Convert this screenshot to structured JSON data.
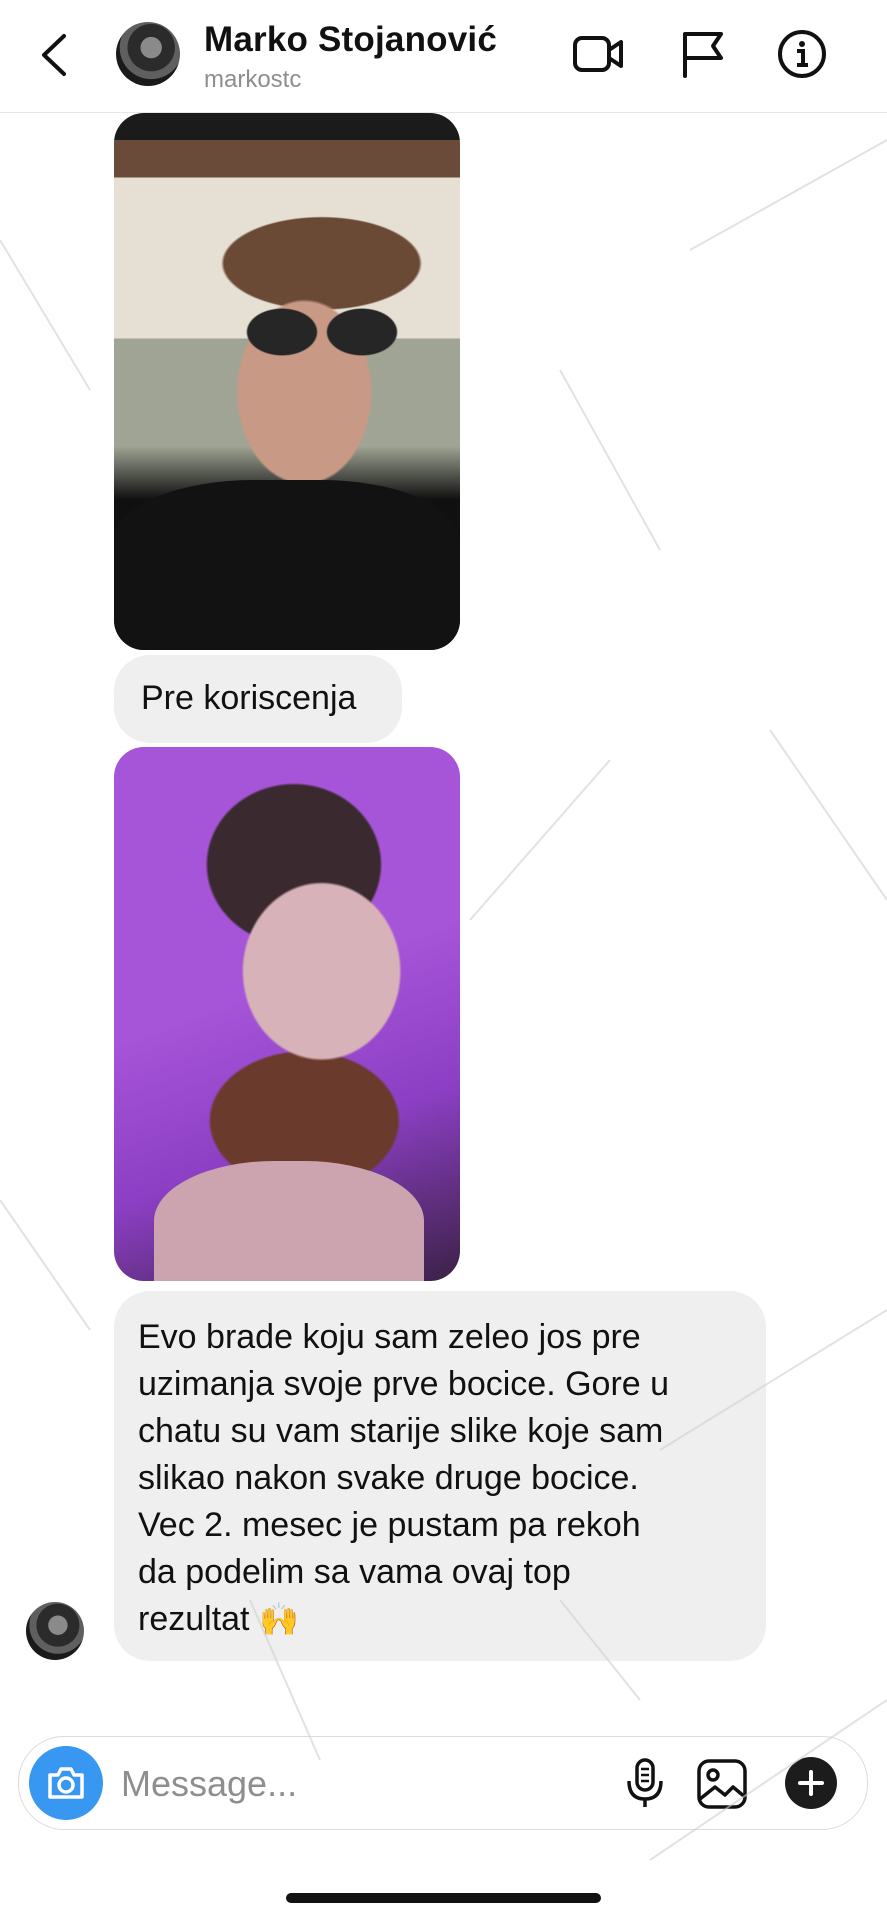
{
  "header": {
    "name": "Marko Stojanović",
    "username": "markostc",
    "icons": [
      "back-chevron-icon",
      "video-call-icon",
      "flag-icon",
      "info-icon"
    ]
  },
  "messages": [
    {
      "type": "photo",
      "description_icon": "photo-selfie-sunglasses"
    },
    {
      "type": "text",
      "text": "Pre koriscenja"
    },
    {
      "type": "photo",
      "description_icon": "photo-selfie-beard"
    },
    {
      "type": "text",
      "text": "Evo brade koju sam zeleo jos pre\nuzimanja svoje prve bocice. Gore u\nchatu su vam starije slike koje sam\nslikao nakon svake druge bocice.\nVec 2. mesec je pustam pa rekoh\nda podelim sa vama ovaj top\nrezultat",
      "emoji": "🙌"
    }
  ],
  "composer": {
    "placeholder": "Message...",
    "icons": [
      "camera-icon",
      "microphone-icon",
      "gallery-icon",
      "plus-icon"
    ]
  },
  "colors": {
    "bubble": "#efefef",
    "accent": "#3897f0",
    "muted_text": "#8e8e8e"
  }
}
